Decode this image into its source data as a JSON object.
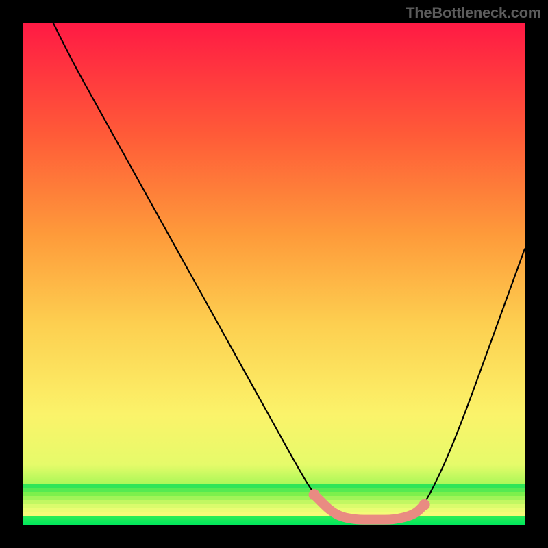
{
  "watermark": "TheBottleneck.com",
  "chart_data": {
    "type": "line",
    "title": "",
    "xlabel": "",
    "ylabel": "",
    "xlim": [
      0,
      100
    ],
    "ylim": [
      0,
      100
    ],
    "series": [
      {
        "name": "curve",
        "x": [
          6,
          10,
          15,
          20,
          25,
          30,
          35,
          40,
          45,
          50,
          55,
          58,
          62,
          66,
          70,
          74,
          78,
          80,
          84,
          88,
          92,
          96,
          100
        ],
        "values": [
          100,
          92,
          83,
          74,
          65,
          56,
          47,
          38,
          29,
          20,
          11,
          6,
          2,
          1,
          1,
          1,
          2,
          4,
          12,
          22,
          33,
          44,
          55
        ]
      },
      {
        "name": "highlight-flat",
        "x": [
          58,
          62,
          66,
          70,
          74,
          78,
          80
        ],
        "values": [
          6,
          2,
          1,
          1,
          1,
          2,
          4
        ]
      }
    ],
    "colors": {
      "curve": "#000000",
      "highlight": "#e98b82"
    },
    "grid": false,
    "legend": false
  }
}
